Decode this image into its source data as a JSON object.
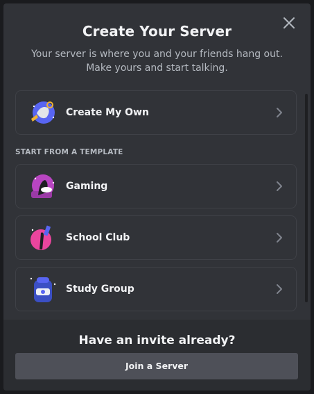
{
  "modal": {
    "title": "Create Your Server",
    "subtitle": "Your server is where you and your friends hang out. Make yours and start talking.",
    "close_icon": "close-icon"
  },
  "create_own": {
    "label": "Create My Own",
    "icon": "create-server-illustration-icon"
  },
  "template_section": {
    "header": "START FROM A TEMPLATE",
    "items": [
      {
        "label": "Gaming",
        "icon": "gaming-illustration-icon"
      },
      {
        "label": "School Club",
        "icon": "school-club-illustration-icon"
      },
      {
        "label": "Study Group",
        "icon": "study-group-illustration-icon"
      }
    ]
  },
  "footer": {
    "title": "Have an invite already?",
    "join_label": "Join a Server"
  },
  "colors": {
    "modal_bg": "#313338",
    "footer_bg": "#2b2d31",
    "button_bg": "#4e5058",
    "text_primary": "#f2f3f5",
    "text_muted": "#b5bac1"
  }
}
